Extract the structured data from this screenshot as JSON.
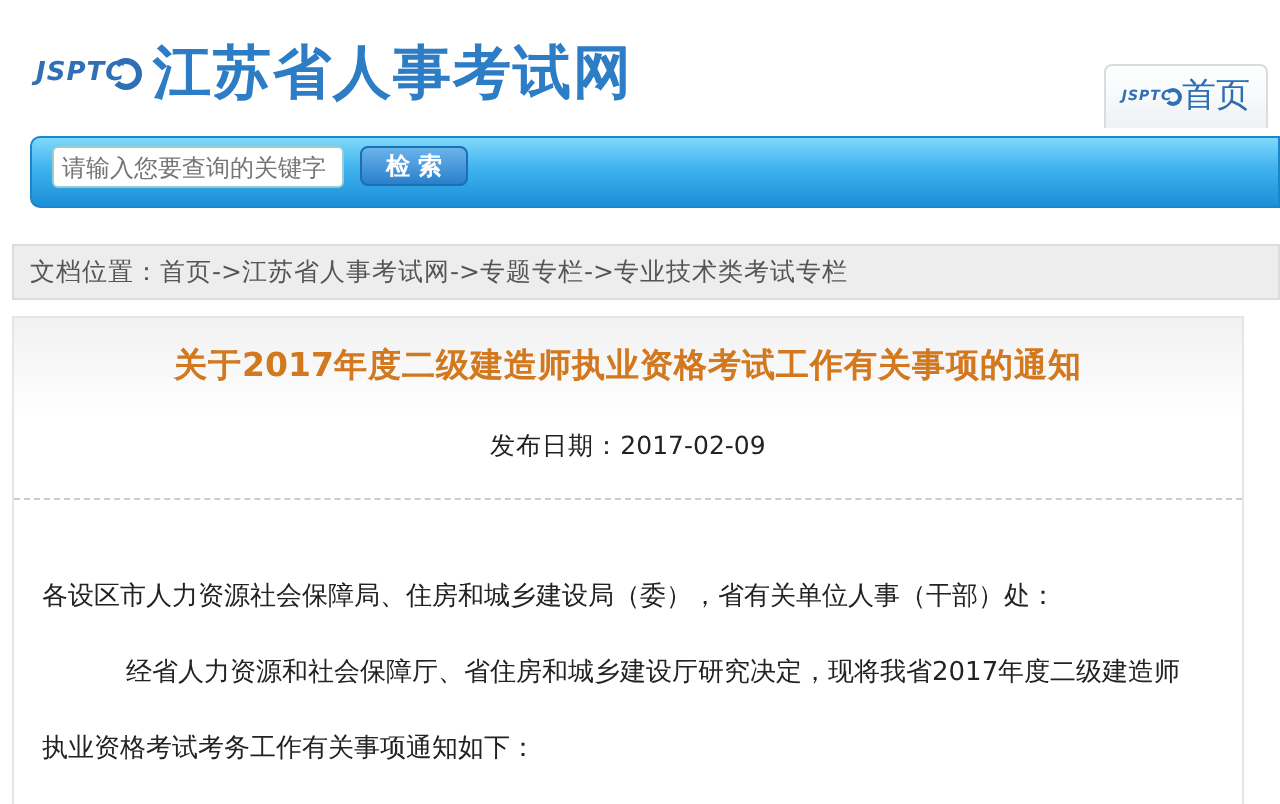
{
  "header": {
    "logo_mark": "JSPTC",
    "site_name": "江苏省人事考试网",
    "tabs": [
      {
        "logo_mark": "JSPTC",
        "label": "首页",
        "selected": true
      }
    ]
  },
  "search": {
    "placeholder": "请输入您要查询的关键字",
    "button": "检 索"
  },
  "breadcrumb": {
    "label": "文档位置：",
    "separator": "->",
    "items": [
      "首页",
      "江苏省人事考试网",
      "专题专栏",
      "专业技术类考试专栏"
    ]
  },
  "article": {
    "title": "关于2017年度二级建造师执业资格考试工作有关事项的通知",
    "date_label": "发布日期：",
    "date": "2017-02-09",
    "paragraphs": [
      {
        "indent": false,
        "lines": [
          "各设区市人力资源社会保障局、住房和城乡建设局（委），省有关单位人事（干部）处："
        ]
      },
      {
        "indent": true,
        "lines": [
          "经省人力资源和社会保障厅、省住房和城乡建设厅研究决定，现将我省2017年度二级建造师",
          "执业资格考试考务工作有关事项通知如下："
        ]
      }
    ]
  }
}
